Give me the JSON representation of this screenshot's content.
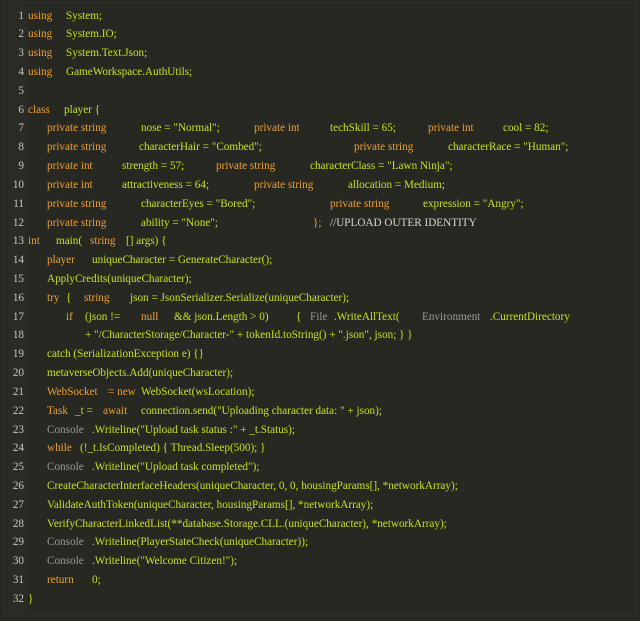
{
  "lines": [
    {
      "num": "1",
      "tokens": [
        [
          "using",
          "kw",
          0
        ],
        [
          "System;",
          "tx",
          38
        ]
      ]
    },
    {
      "num": "2",
      "tokens": [
        [
          "using",
          "kw",
          0
        ],
        [
          "System.IO;",
          "tx",
          38
        ]
      ]
    },
    {
      "num": "3",
      "tokens": [
        [
          "using",
          "kw",
          0
        ],
        [
          "System.Text.Json;",
          "tx",
          38
        ]
      ]
    },
    {
      "num": "4",
      "tokens": [
        [
          "using",
          "kw",
          0
        ],
        [
          "GameWorkspace.AuthUtils;",
          "tx",
          38
        ]
      ]
    },
    {
      "num": "5",
      "tokens": []
    },
    {
      "num": "6",
      "tokens": [
        [
          "class",
          "kw",
          0
        ],
        [
          "player {",
          "tx",
          36
        ]
      ]
    },
    {
      "num": "7",
      "tokens": [
        [
          "private string",
          "kw",
          19
        ],
        [
          "nose = \"Normal\";",
          "tx",
          113
        ],
        [
          "private int",
          "kw",
          226
        ],
        [
          "techSkill = 65;",
          "tx",
          302
        ],
        [
          "private int",
          "kw",
          400
        ],
        [
          "cool = 82;",
          "tx",
          475
        ]
      ]
    },
    {
      "num": "8",
      "tokens": [
        [
          "private string",
          "kw",
          19
        ],
        [
          "characterHair = \"Combed\";",
          "tx",
          111
        ],
        [
          "private string",
          "kw",
          326
        ],
        [
          "characterRace = \"Human\";",
          "tx",
          420
        ]
      ]
    },
    {
      "num": "9",
      "tokens": [
        [
          "private int",
          "kw",
          19
        ],
        [
          "strength = 57;",
          "tx",
          94
        ],
        [
          "private string",
          "kw",
          188
        ],
        [
          "characterClass = \"Lawn Ninja\";",
          "tx",
          282
        ]
      ]
    },
    {
      "num": "10",
      "tokens": [
        [
          "private int",
          "kw",
          19
        ],
        [
          "attractiveness = 64;",
          "tx",
          94
        ],
        [
          "private string",
          "kw",
          226
        ],
        [
          "allocation = Medium;",
          "tx",
          320
        ]
      ]
    },
    {
      "num": "11",
      "tokens": [
        [
          "private string",
          "kw",
          19
        ],
        [
          "characterEyes = \"Bored\";",
          "tx",
          113
        ],
        [
          "private string",
          "kw",
          302
        ],
        [
          "expression = \"Angry\";",
          "tx",
          395
        ]
      ]
    },
    {
      "num": "12",
      "tokens": [
        [
          "private string",
          "kw",
          19
        ],
        [
          "ability = \"None\";",
          "tx",
          113
        ],
        [
          "};",
          "kw",
          285
        ],
        [
          "//UPLOAD OUTER IDENTITY",
          "wh",
          302
        ]
      ]
    },
    {
      "num": "13",
      "tokens": [
        [
          "int",
          "kw",
          0
        ],
        [
          "main(",
          "tx",
          28
        ],
        [
          "string",
          "kw",
          62
        ],
        [
          "[] args) {",
          "tx",
          98
        ]
      ]
    },
    {
      "num": "14",
      "tokens": [
        [
          "player",
          "kw",
          19
        ],
        [
          "uniqueCharacter = GenerateCharacter();",
          "tx",
          64
        ]
      ]
    },
    {
      "num": "15",
      "tokens": [
        [
          "ApplyCredits(uniqueCharacter);",
          "tx",
          19
        ]
      ]
    },
    {
      "num": "16",
      "tokens": [
        [
          "try",
          "kw",
          19
        ],
        [
          "{",
          "tx",
          38
        ],
        [
          "string",
          "kw",
          56
        ],
        [
          "json = JsonSerializer.Serialize(uniqueCharacter);",
          "tx",
          102
        ]
      ]
    },
    {
      "num": "17",
      "tokens": [
        [
          "if",
          "kw",
          38
        ],
        [
          "(json !=",
          "tx",
          57
        ],
        [
          "null",
          "kw",
          113
        ],
        [
          "&& json.Length > 0)",
          "tx",
          146
        ],
        [
          "{",
          "tx",
          268
        ],
        [
          "File",
          "gr",
          282
        ],
        [
          ".WriteAllText(",
          "tx",
          306
        ],
        [
          "Environment",
          "gr",
          394
        ],
        [
          ".CurrentDirectory",
          "tx",
          462
        ]
      ]
    },
    {
      "num": "18",
      "tokens": [
        [
          "+ \"/CharacterStorage/Character-\" + tokenId.toString() + \".json\", json; } }",
          "tx",
          57
        ]
      ]
    },
    {
      "num": "19",
      "tokens": [
        [
          "catch (SerializationException e) {}",
          "tx",
          19
        ]
      ]
    },
    {
      "num": "20",
      "tokens": [
        [
          "metaverseObjects.Add(uniqueCharacter);",
          "tx",
          19
        ]
      ]
    },
    {
      "num": "21",
      "tokens": [
        [
          "WebSocket",
          "kw",
          19
        ],
        [
          "= new",
          "kw",
          80
        ],
        [
          "WebSocket(wsLocation);",
          "tx",
          113
        ]
      ]
    },
    {
      "num": "22",
      "tokens": [
        [
          "Task",
          "kw",
          19
        ],
        [
          "_t =",
          "tx",
          47
        ],
        [
          "await",
          "kw",
          75
        ],
        [
          "connection.send(\"Uploading character data: \" + json);",
          "tx",
          113
        ]
      ]
    },
    {
      "num": "23",
      "tokens": [
        [
          "Console",
          "gr",
          19
        ],
        [
          ".Writeline(\"Upload task status :\" + _t.Status);",
          "tx",
          64
        ]
      ]
    },
    {
      "num": "24",
      "tokens": [
        [
          "while",
          "kw",
          19
        ],
        [
          "(!_t.IsCompleted) { Thread.Sleep(500); }",
          "tx",
          52
        ]
      ]
    },
    {
      "num": "25",
      "tokens": [
        [
          "Console",
          "gr",
          19
        ],
        [
          ".Writeline(\"Upload task completed\");",
          "tx",
          64
        ]
      ]
    },
    {
      "num": "26",
      "tokens": [
        [
          "CreateCharacterInterfaceHeaders(uniqueCharacter, 0, 0, housingParams[], *networkArray);",
          "tx",
          19
        ]
      ]
    },
    {
      "num": "27",
      "tokens": [
        [
          "ValidateAuthToken(uniqueCharacter, housingParams[], *networkArray);",
          "tx",
          19
        ]
      ]
    },
    {
      "num": "28",
      "tokens": [
        [
          "VerifyCharacterLinkedList(**database.Storage.CLL.(uniqueCharacter), *networkArray);",
          "tx",
          19
        ]
      ]
    },
    {
      "num": "29",
      "tokens": [
        [
          "Console",
          "gr",
          19
        ],
        [
          ".Writeline(PlayerStateCheck(uniqueCharacter));",
          "tx",
          64
        ]
      ]
    },
    {
      "num": "30",
      "tokens": [
        [
          "Console",
          "gr",
          19
        ],
        [
          ".Writeline(\"Welcome Citizen!\");",
          "tx",
          64
        ]
      ]
    },
    {
      "num": "31",
      "tokens": [
        [
          "return",
          "kw",
          19
        ],
        [
          "0;",
          "tx",
          64
        ]
      ]
    },
    {
      "num": "32",
      "tokens": [
        [
          "}",
          "tx",
          0
        ]
      ]
    }
  ]
}
